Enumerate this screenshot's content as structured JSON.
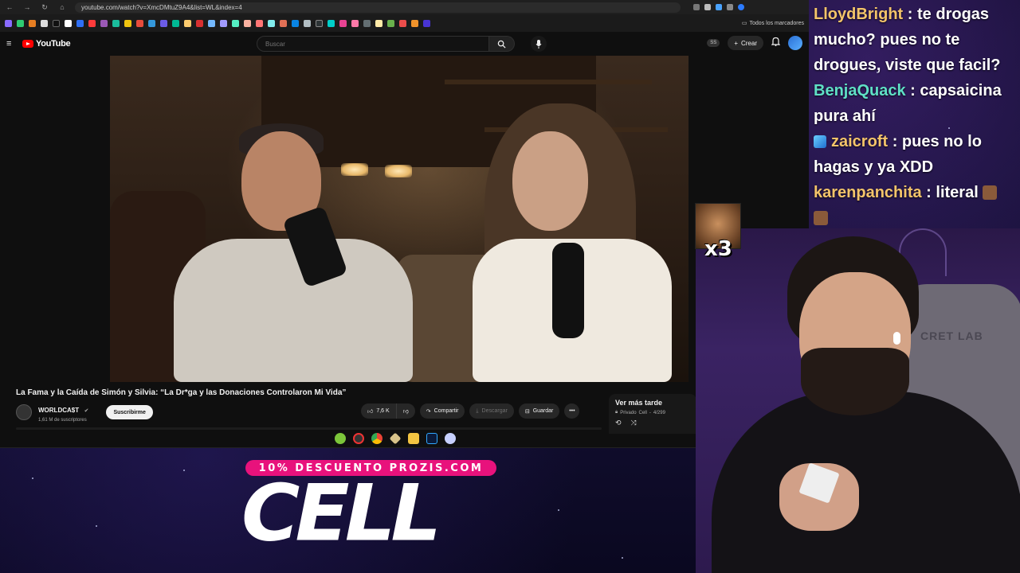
{
  "browser": {
    "url": "youtube.com/watch?v=XmcDMtuZ9A4&list=WL&index=4",
    "bookmarks_folder": "Todos los marcadores"
  },
  "youtube": {
    "logo_text": "YouTube",
    "search_placeholder": "Buscar",
    "badge": "SS",
    "create_label": "Crear"
  },
  "video": {
    "title": "La Fama y la Caída de Simón y Silvia: “La Dr*ga y las Donaciones Controlaron Mi Vida”",
    "channel_name": "WORLDCA$T",
    "subscribers": "1,61 M de suscriptores",
    "subscribe_label": "Suscribirme",
    "likes": "7,6 K",
    "share_label": "Compartir",
    "download_label": "Descargar",
    "save_label": "Guardar"
  },
  "playlist": {
    "title": "Ver más tarde",
    "privacy": "Privado",
    "owner": "Cell",
    "position": "4/299"
  },
  "chat": [
    {
      "user": "LloydBright",
      "text": "te drogas mucho? pues no te drogues, viste que facil?"
    },
    {
      "user": "BenjaQuack",
      "text": "capsaicina pura ahí"
    },
    {
      "user": "zaicroft",
      "text": "pues no lo hagas y ya XDD"
    },
    {
      "user": "karenpanchita",
      "text": "literal"
    }
  ],
  "emote": {
    "multiplier": "x3"
  },
  "webcam": {
    "chair_brand": "CRET LAB"
  },
  "sponsor": {
    "promo": "10% DESCUENTO PROZIS.COM",
    "logo": "CELL"
  },
  "colors": {
    "youtube_red": "#ff0000",
    "sponsor_pink": "#e8127c",
    "chat_gold": "#f3c46a",
    "chat_teal": "#5fe0c6"
  }
}
